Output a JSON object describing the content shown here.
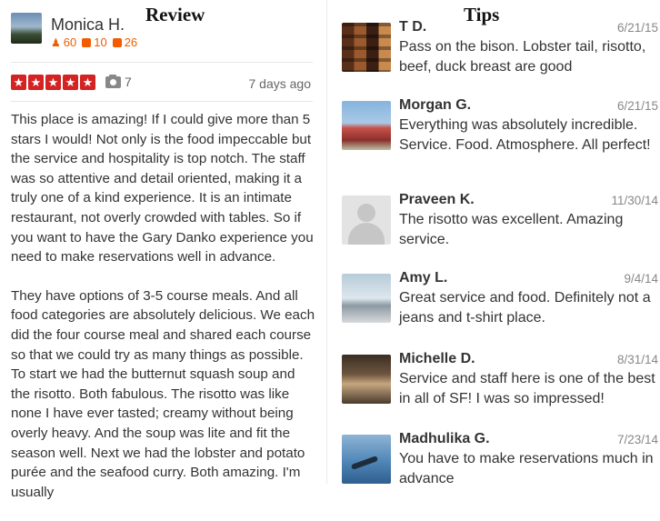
{
  "headings": {
    "review": "Review",
    "tips": "Tips"
  },
  "review": {
    "reviewer_name": "Monica H.",
    "stats": {
      "friends": "60",
      "reviews": "10",
      "photos": "26"
    },
    "rating": 5,
    "photo_count": "7",
    "date": "7 days ago",
    "paragraphs": [
      "This place is amazing! If I could give more than 5 stars I would! Not only is the food impeccable but the service and hospitality is top notch. The staff was so attentive and detail oriented, making it a truly one of a kind experience. It is an intimate restaurant, not overly crowded with tables. So if you want to have the Gary Danko experience you need to make reservations well in advance.",
      "They have options of 3-5 course meals. And all food categories are absolutely delicious. We each did the four course meal and shared each course so that we could try as many things as possible. To start we had the butternut squash soup and the risotto. Both fabulous. The risotto was like none I have ever tasted; creamy without being overly heavy. And the soup was lite and fit the season well. Next we had the lobster and potato purée and the seafood curry. Both amazing. I'm usually"
    ]
  },
  "tips": [
    {
      "name": "T D.",
      "date": "6/21/15",
      "text": "Pass on the bison. Lobster tail, risotto, beef, duck breast are good"
    },
    {
      "name": "Morgan G.",
      "date": "6/21/15",
      "text": "Everything was absolutely incredible. Service. Food. Atmosphere.  All perfect!"
    },
    {
      "name": "Praveen K.",
      "date": "11/30/14",
      "text": "The risotto was excellent. Amazing service."
    },
    {
      "name": "Amy L.",
      "date": "9/4/14",
      "text": "Great service and food. Definitely not a jeans and t-shirt place."
    },
    {
      "name": "Michelle D.",
      "date": "8/31/14",
      "text": "Service and staff here is one of the best in all of SF! I was so impressed!"
    },
    {
      "name": "Madhulika G.",
      "date": "7/23/14",
      "text": "You have to make reservations much in advance"
    }
  ],
  "colors": {
    "star_red": "#d32323",
    "stat_orange": "#f15c00"
  },
  "icons": [
    "friends-icon",
    "review-count-icon",
    "photo-count-icon",
    "star-icon",
    "camera-icon"
  ]
}
